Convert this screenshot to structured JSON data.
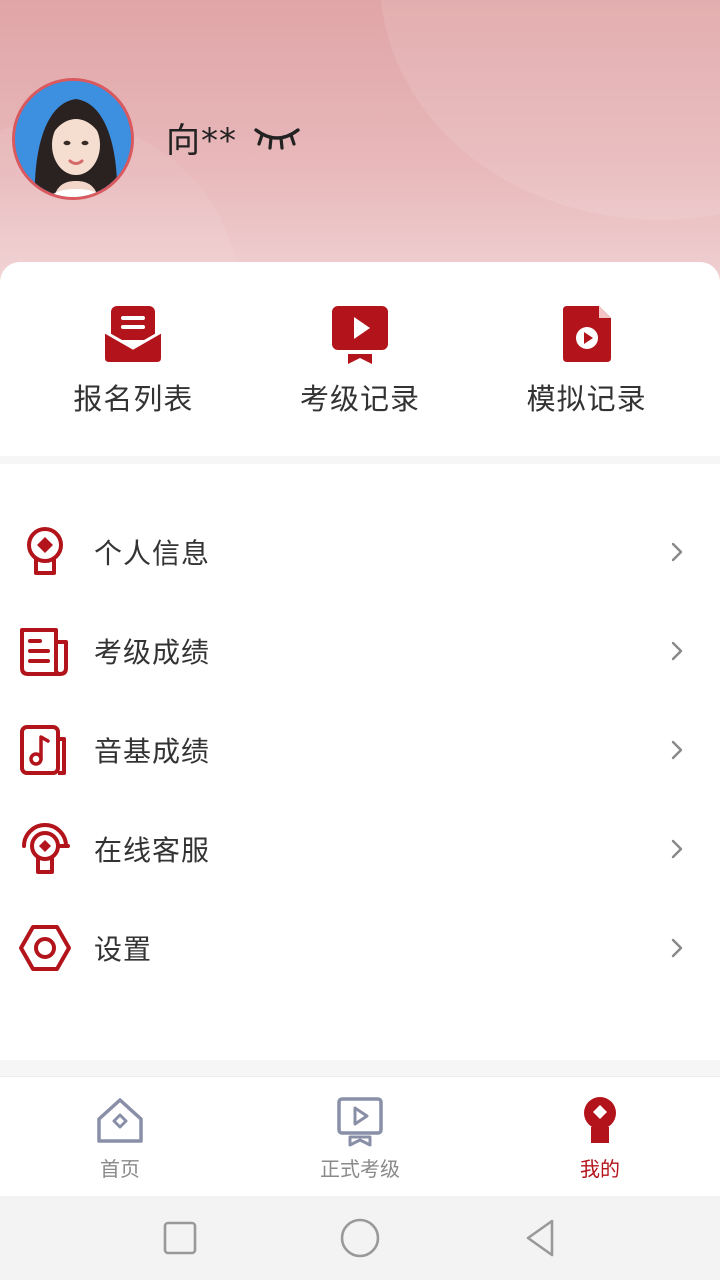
{
  "header": {
    "username": "向**",
    "avatar_icon": "user-avatar-photo",
    "visibility_icon": "eye-closed-icon"
  },
  "quick_actions": [
    {
      "label": "报名列表",
      "icon": "envelope-list-icon"
    },
    {
      "label": "考级记录",
      "icon": "video-badge-icon"
    },
    {
      "label": "模拟记录",
      "icon": "file-play-icon"
    }
  ],
  "menu": [
    {
      "label": "个人信息",
      "icon": "person-info-icon"
    },
    {
      "label": "考级成绩",
      "icon": "newspaper-icon"
    },
    {
      "label": "音基成绩",
      "icon": "music-note-icon"
    },
    {
      "label": "在线客服",
      "icon": "headset-icon"
    },
    {
      "label": "设置",
      "icon": "hexagon-settings-icon"
    }
  ],
  "tabbar": [
    {
      "label": "首页",
      "icon": "home-icon",
      "active": false
    },
    {
      "label": "正式考级",
      "icon": "video-badge-icon",
      "active": false
    },
    {
      "label": "我的",
      "icon": "user-icon",
      "active": true
    }
  ],
  "colors": {
    "accent": "#b3141b",
    "header_top": "#e0a5a7",
    "header_bottom": "#f1d4d5",
    "inactive": "#8a8a8a"
  },
  "system_nav": [
    "recent-apps-icon",
    "home-circle-icon",
    "back-triangle-icon"
  ]
}
